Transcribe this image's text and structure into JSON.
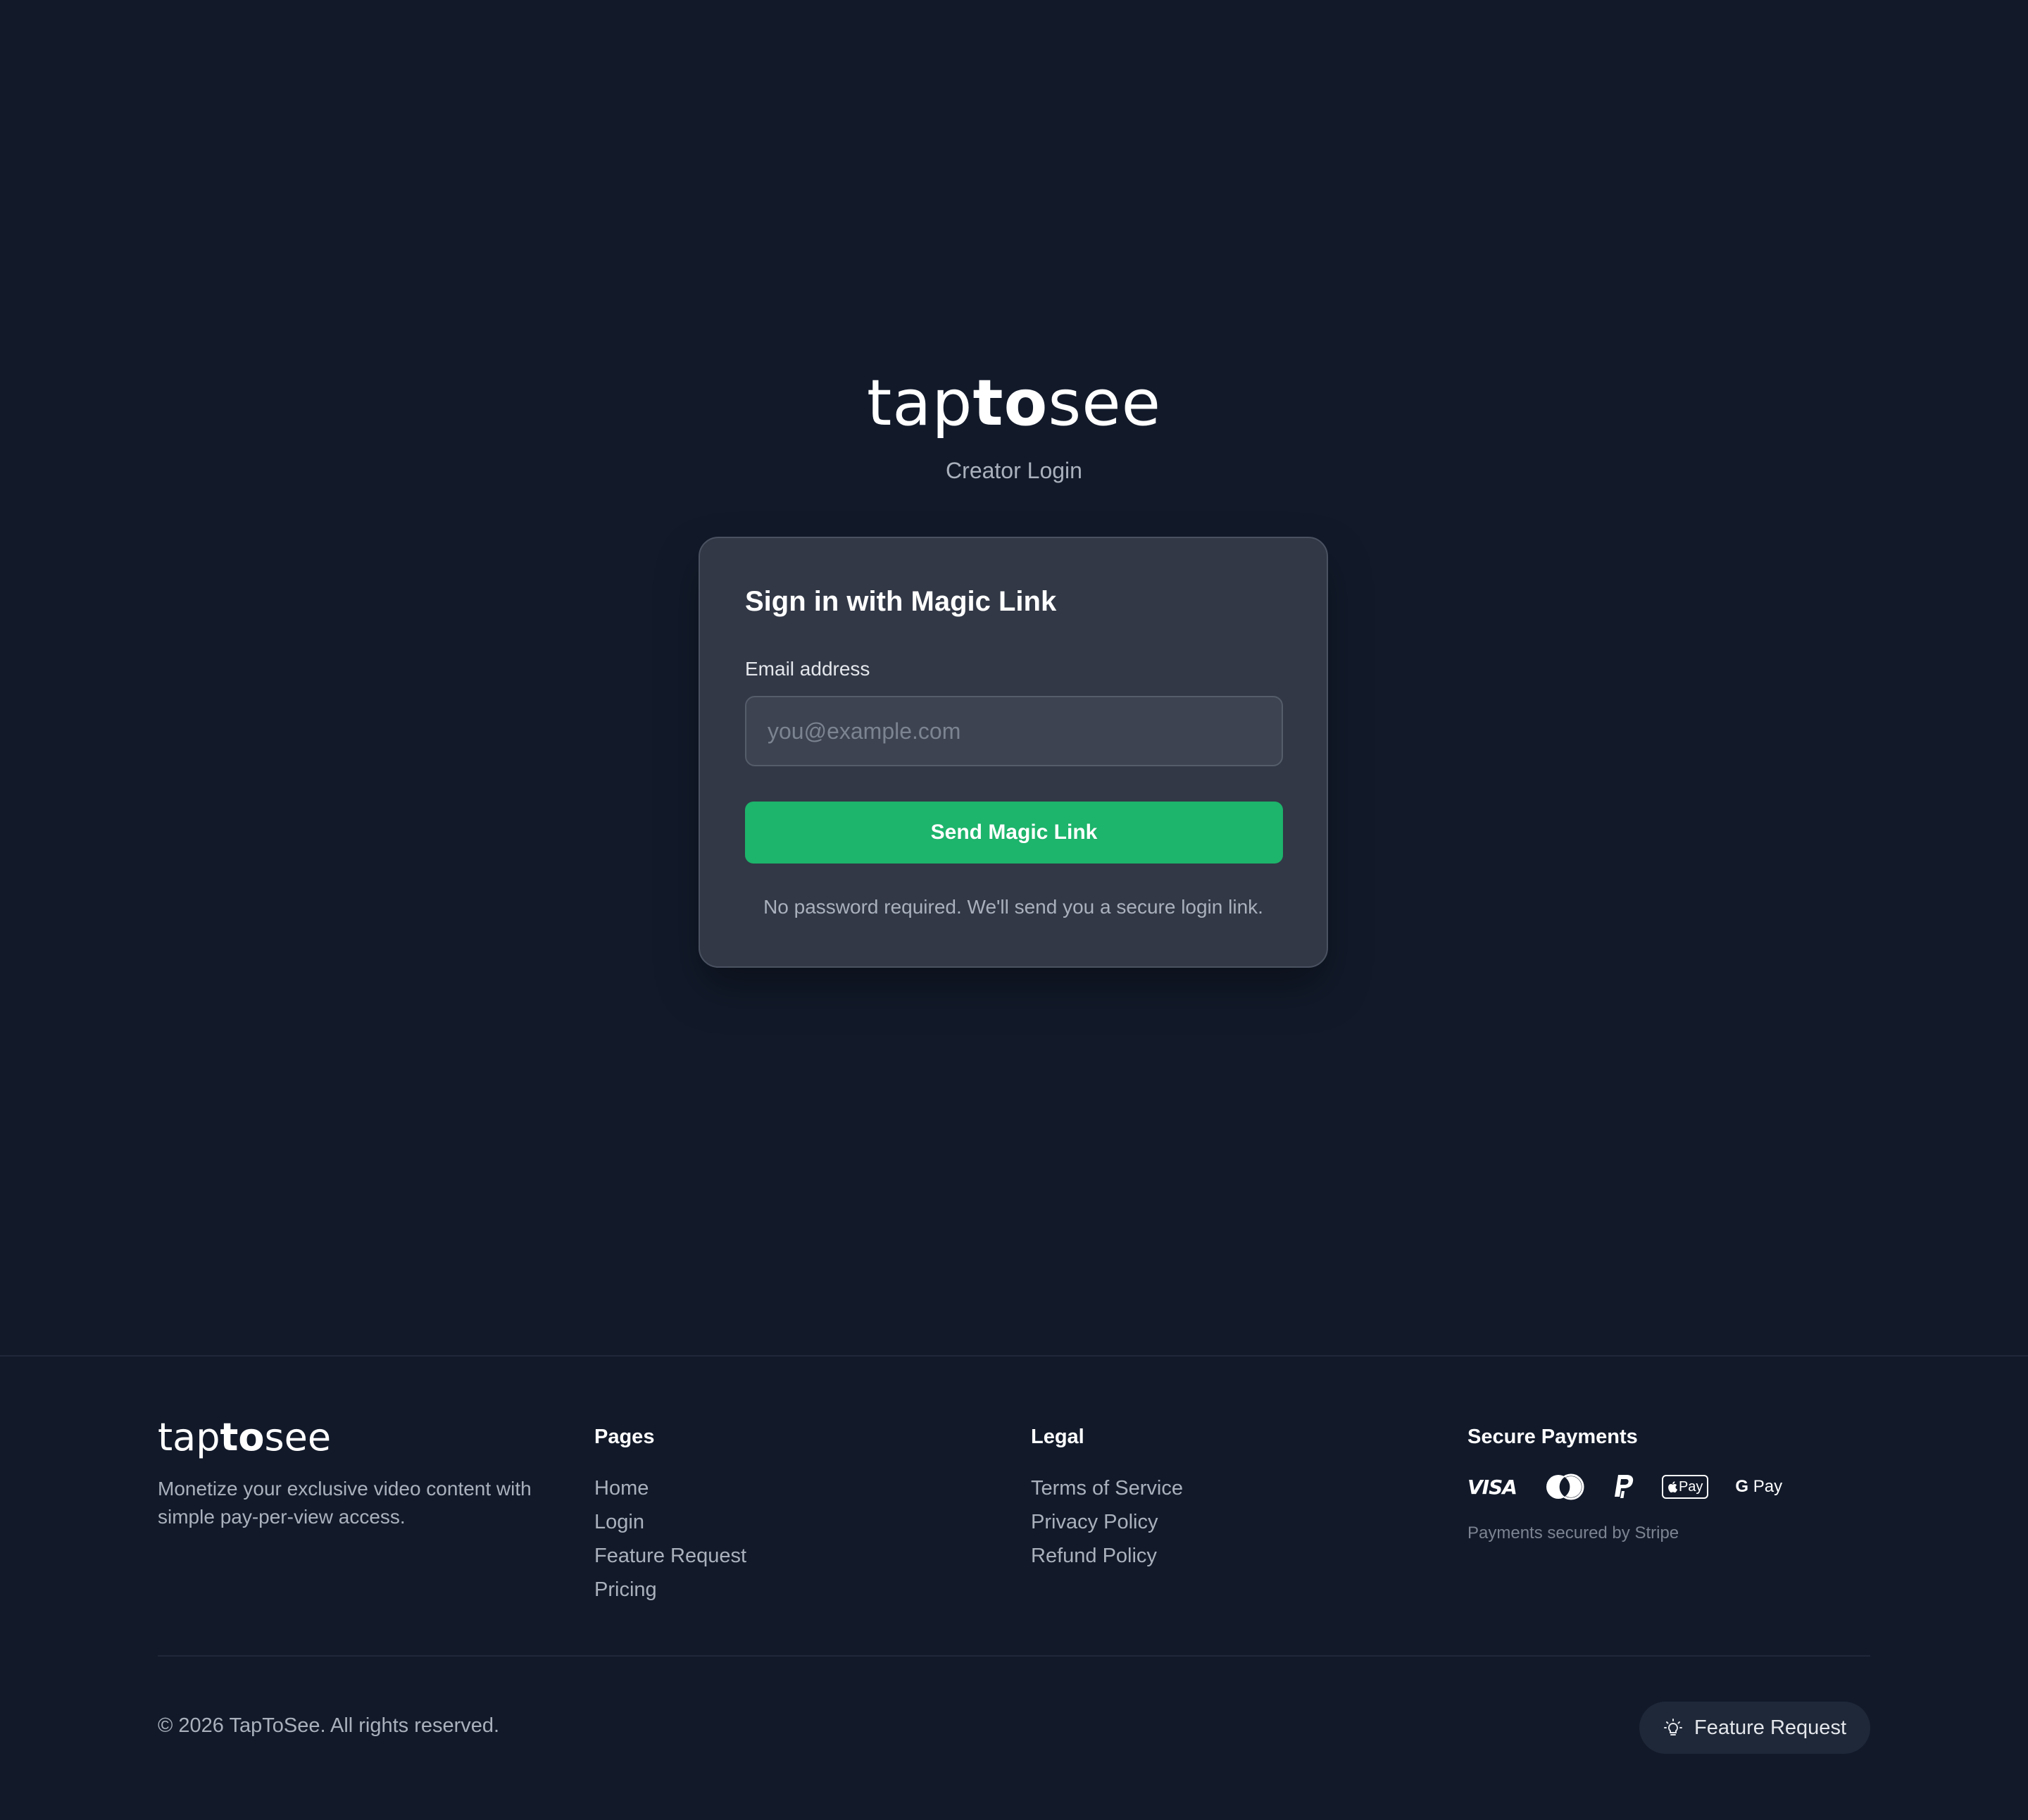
{
  "header": {
    "brand_light": "tap",
    "brand_bold": "to",
    "brand_light_end": "see",
    "subtitle": "Creator Login"
  },
  "login_card": {
    "title": "Sign in with Magic Link",
    "email_label": "Email address",
    "email_placeholder": "you@example.com",
    "email_value": "",
    "submit_label": "Send Magic Link",
    "note": "No password required. We'll send you a secure login link."
  },
  "footer": {
    "brand_light": "tap",
    "brand_bold": "to",
    "brand_light_end": "see",
    "tagline": "Monetize your exclusive video content with simple pay-per-view access.",
    "pages": {
      "heading": "Pages",
      "links": [
        "Home",
        "Login",
        "Feature Request",
        "Pricing"
      ]
    },
    "legal": {
      "heading": "Legal",
      "links": [
        "Terms of Service",
        "Privacy Policy",
        "Refund Policy"
      ]
    },
    "payments": {
      "heading": "Secure Payments",
      "icons": [
        "visa-icon",
        "mastercard-icon",
        "paypal-icon",
        "apple-pay-icon",
        "google-pay-icon"
      ],
      "visa_text": "VISA",
      "applepay_text": "Pay",
      "gpay_g": "G",
      "gpay_text": "Pay",
      "note": "Payments secured by Stripe"
    },
    "copyright": "© 2026 TapToSee. All rights reserved.",
    "feature_request_label": "Feature Request"
  },
  "colors": {
    "background": "#121a2a",
    "card": "#323846",
    "accent_green": "#1db46b",
    "muted_text": "#aab1bd"
  }
}
